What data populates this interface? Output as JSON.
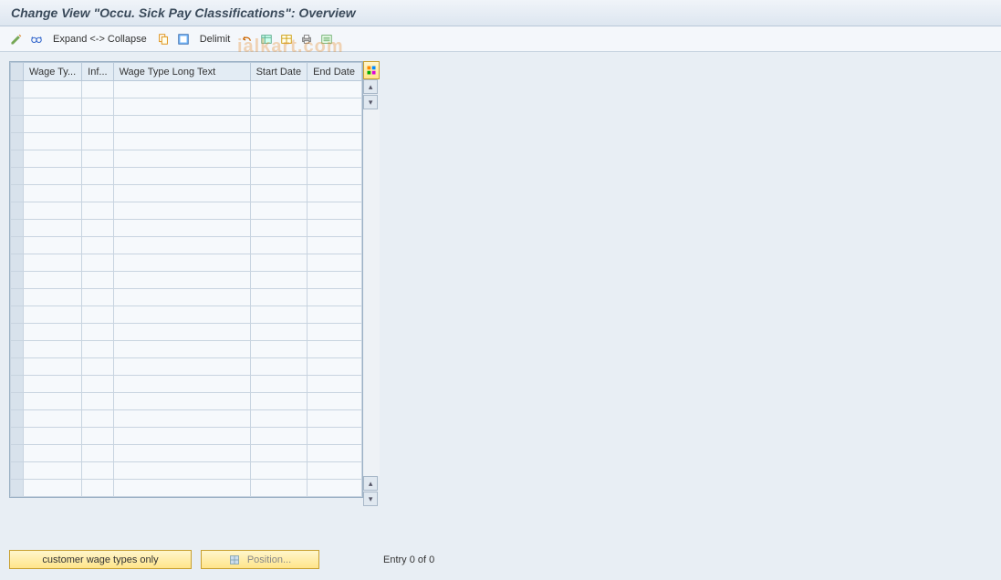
{
  "header": {
    "title": "Change View \"Occu. Sick Pay Classifications\": Overview"
  },
  "toolbar": {
    "expand_collapse": "Expand <-> Collapse",
    "delimit": "Delimit"
  },
  "table": {
    "columns": {
      "wage_type": "Wage Ty...",
      "inf": "Inf...",
      "long_text": "Wage Type Long Text",
      "start_date": "Start Date",
      "end_date": "End Date"
    },
    "row_count": 24
  },
  "footer": {
    "customer_btn": "customer wage types only",
    "position_btn": "Position...",
    "entry_text": "Entry 0 of 0"
  },
  "watermark": "ialkart.com"
}
